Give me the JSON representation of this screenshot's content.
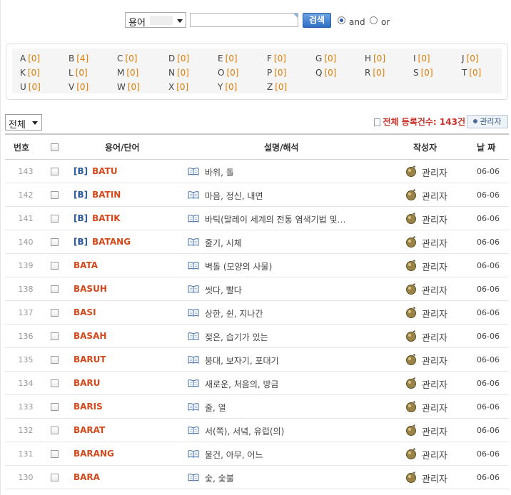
{
  "search": {
    "field_label": "용어",
    "input_value": "",
    "button_label": "검색",
    "radio_and": "and",
    "radio_or": "or",
    "selected": "and"
  },
  "alphabet": [
    {
      "letter": "A",
      "count": "[0]"
    },
    {
      "letter": "B",
      "count": "[4]"
    },
    {
      "letter": "C",
      "count": "[0]"
    },
    {
      "letter": "D",
      "count": "[0]"
    },
    {
      "letter": "E",
      "count": "[0]"
    },
    {
      "letter": "F",
      "count": "[0]"
    },
    {
      "letter": "G",
      "count": "[0]"
    },
    {
      "letter": "H",
      "count": "[0]"
    },
    {
      "letter": "I",
      "count": "[0]"
    },
    {
      "letter": "J",
      "count": "[0]"
    },
    {
      "letter": "K",
      "count": "[0]"
    },
    {
      "letter": "L",
      "count": "[0]"
    },
    {
      "letter": "M",
      "count": "[0]"
    },
    {
      "letter": "N",
      "count": "[0]"
    },
    {
      "letter": "O",
      "count": "[0]"
    },
    {
      "letter": "P",
      "count": "[0]"
    },
    {
      "letter": "Q",
      "count": "[0]"
    },
    {
      "letter": "R",
      "count": "[0]"
    },
    {
      "letter": "S",
      "count": "[0]"
    },
    {
      "letter": "T",
      "count": "[0]"
    },
    {
      "letter": "U",
      "count": "[0]"
    },
    {
      "letter": "V",
      "count": "[0]"
    },
    {
      "letter": "W",
      "count": "[0]"
    },
    {
      "letter": "X",
      "count": "[0]"
    },
    {
      "letter": "Y",
      "count": "[0]"
    },
    {
      "letter": "Z",
      "count": "[0]"
    }
  ],
  "category_select": "전체",
  "register_count": "전체 등록건수: 143건",
  "admin_button": "관리자",
  "table": {
    "headers": {
      "num": "번호",
      "word": "용어/단어",
      "desc": "설명/해석",
      "author": "작성자",
      "date": "날 짜"
    },
    "rows": [
      {
        "num": "143",
        "prefix": "[B]",
        "word": "BATU",
        "desc": "바위, 돌",
        "author": "관리자",
        "date": "06-06"
      },
      {
        "num": "142",
        "prefix": "[B]",
        "word": "BATIN",
        "desc": "마음, 정신, 내면",
        "author": "관리자",
        "date": "06-06"
      },
      {
        "num": "141",
        "prefix": "[B]",
        "word": "BATIK",
        "desc": "바틱(말레이 세계의 전통 염색기법 및…",
        "author": "관리자",
        "date": "06-06"
      },
      {
        "num": "140",
        "prefix": "[B]",
        "word": "BATANG",
        "desc": "줄기, 시체",
        "author": "관리자",
        "date": "06-06"
      },
      {
        "num": "139",
        "prefix": "",
        "word": "BATA",
        "desc": "벽돌 (모양의 사물)",
        "author": "관리자",
        "date": "06-06"
      },
      {
        "num": "138",
        "prefix": "",
        "word": "BASUH",
        "desc": "씻다, 빨다",
        "author": "관리자",
        "date": "06-06"
      },
      {
        "num": "137",
        "prefix": "",
        "word": "BASI",
        "desc": "상한, 쉰, 지나간",
        "author": "관리자",
        "date": "06-06"
      },
      {
        "num": "136",
        "prefix": "",
        "word": "BASAH",
        "desc": "젖은, 습기가 있는",
        "author": "관리자",
        "date": "06-06"
      },
      {
        "num": "135",
        "prefix": "",
        "word": "BARUT",
        "desc": "붕대, 보자기, 포대기",
        "author": "관리자",
        "date": "06-06"
      },
      {
        "num": "134",
        "prefix": "",
        "word": "BARU",
        "desc": "새로운, 처음의, 방금",
        "author": "관리자",
        "date": "06-06"
      },
      {
        "num": "133",
        "prefix": "",
        "word": "BARIS",
        "desc": "줄, 열",
        "author": "관리자",
        "date": "06-06"
      },
      {
        "num": "132",
        "prefix": "",
        "word": "BARAT",
        "desc": "서(쪽), 서녘, 유럽(의)",
        "author": "관리자",
        "date": "06-06"
      },
      {
        "num": "131",
        "prefix": "",
        "word": "BARANG",
        "desc": "물건, 아무, 어느",
        "author": "관리자",
        "date": "06-06"
      },
      {
        "num": "130",
        "prefix": "",
        "word": "BARA",
        "desc": "숯, 숯불",
        "author": "관리자",
        "date": "06-06"
      }
    ]
  }
}
